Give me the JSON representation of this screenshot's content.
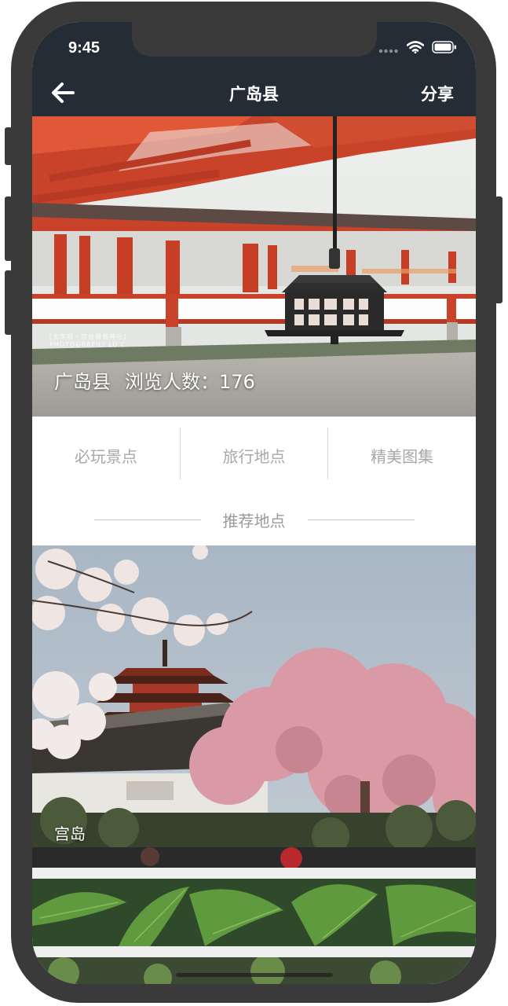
{
  "status_bar": {
    "time": "9:45",
    "icons": [
      "signal-dots-icon",
      "wifi-icon",
      "battery-icon"
    ]
  },
  "nav": {
    "back_icon": "arrow-left-icon",
    "title": "广岛县",
    "share_label": "分享"
  },
  "hero": {
    "location": "广岛县",
    "views_label": "浏览人数：176",
    "watermark_line1": "[太宰府・宮島厳島神社]",
    "watermark_line2": "PHOTOGRAPHY LU.C"
  },
  "tabs": [
    {
      "label": "必玩景点"
    },
    {
      "label": "旅行地点"
    },
    {
      "label": "精美图集"
    }
  ],
  "section": {
    "title": "推荐地点"
  },
  "places": [
    {
      "name": "宫岛"
    },
    {
      "name": ""
    }
  ],
  "colors": {
    "nav_bg": "#242c36",
    "tab_text": "#a8a8a8",
    "section_text": "#9a9a9a",
    "device_frame": "#3a3a3a"
  }
}
